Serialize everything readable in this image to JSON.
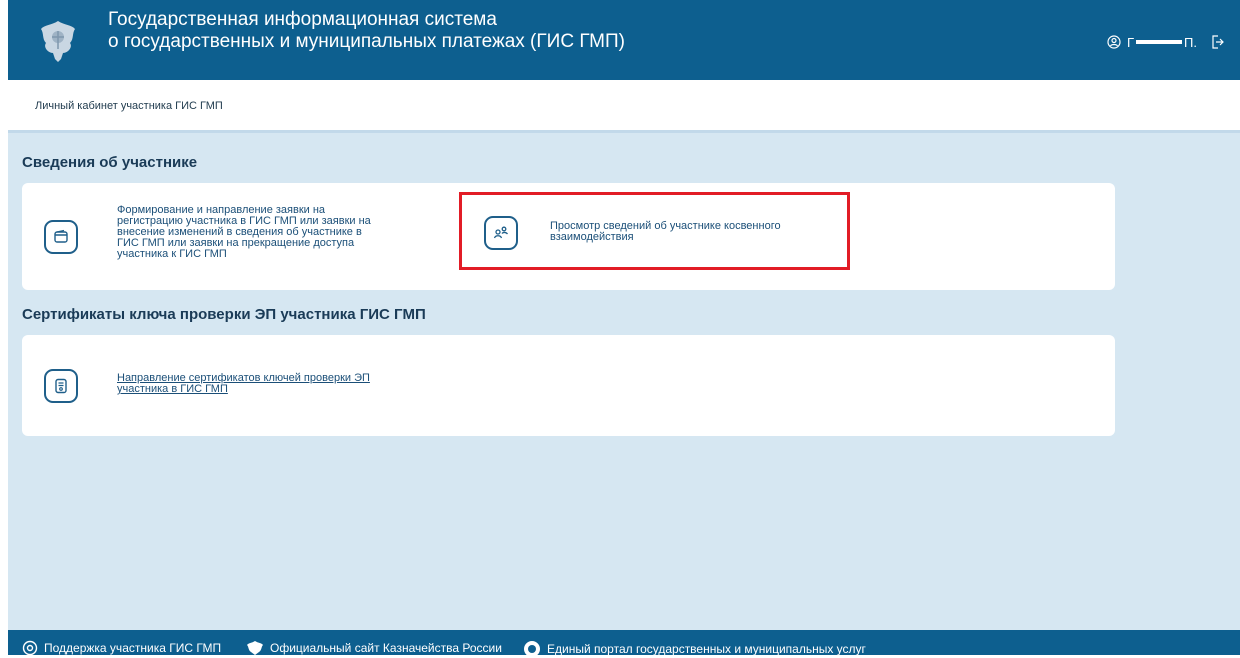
{
  "header": {
    "title_line1": "Государственная информационная система",
    "title_line2": "о государственных и муниципальных платежах (ГИС ГМП)",
    "user_initial": "Г",
    "user_suffix": "П."
  },
  "breadcrumb": "Личный кабинет участника ГИС ГМП",
  "sections": [
    {
      "title": "Сведения об участнике",
      "items": [
        {
          "icon": "wallet-icon",
          "lines": [
            "Формирование и направление заявки на",
            "регистрацию участника в ГИС ГМП или заявки на",
            "внесение изменений в сведения об участнике в",
            "ГИС ГМП или заявки на прекращение доступа",
            "участника к ГИС ГМП"
          ]
        },
        {
          "icon": "users-icon",
          "lines": [
            "Просмотр сведений об участнике косвенного",
            "взаимодействия"
          ]
        }
      ]
    },
    {
      "title": "Сертификаты ключа проверки ЭП участника ГИС ГМП",
      "items": [
        {
          "icon": "certificate-icon",
          "lines": [
            "Направление сертификатов ключей проверки ЭП",
            "участника в ГИС ГМП"
          ]
        }
      ]
    }
  ],
  "footer": {
    "links": [
      "Поддержка участника ГИС ГМП",
      "Официальный сайт Казначейства России",
      "Единый портал государственных и муниципальных услуг"
    ]
  },
  "colors": {
    "header_bg": "#0d5f8f",
    "page_bg": "#d6e7f2",
    "highlight": "#e21c26",
    "accent_text": "#1b4f78"
  }
}
